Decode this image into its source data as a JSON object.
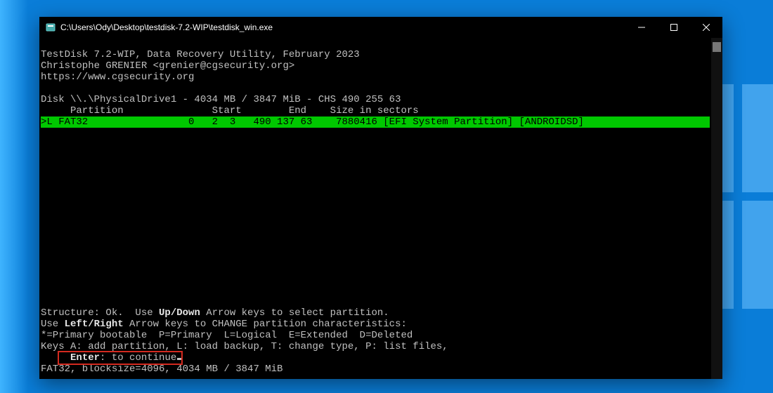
{
  "window": {
    "title": "C:\\Users\\Ody\\Desktop\\testdisk-7.2-WIP\\testdisk_win.exe"
  },
  "header": {
    "line1": "TestDisk 7.2-WIP, Data Recovery Utility, February 2023",
    "line2": "Christophe GRENIER <grenier@cgsecurity.org>",
    "line3": "https://www.cgsecurity.org"
  },
  "disk_line": "Disk \\\\.\\PhysicalDrive1 - 4034 MB / 3847 MiB - CHS 490 255 63",
  "table": {
    "header": "     Partition               Start        End    Size in sectors",
    "row1": ">L FAT32                 0   2  3   490 137 63    7880416 [EFI System Partition] [ANDROIDSD]"
  },
  "footer": {
    "structure_pre": "Structure: Ok.  Use ",
    "updown": "Up/Down",
    "structure_post": " Arrow keys to select partition.",
    "use_pre": "Use ",
    "leftright": "Left/Right",
    "use_post": " Arrow keys to CHANGE partition characteristics:",
    "legend": "*=Primary bootable  P=Primary  L=Logical  E=Extended  D=Deleted",
    "keys_line": "Keys A: add partition, L: load backup, T: change type, P: list files,",
    "enter_pre": "     ",
    "enter_bold": "Enter",
    "enter_post": ": to continue",
    "fsinfo": "FAT32, blocksize=4096, 4034 MB / 3847 MiB"
  },
  "icons": {
    "app": "app-icon",
    "minimize": "minimize-icon",
    "maximize": "maximize-icon",
    "close": "close-icon"
  }
}
